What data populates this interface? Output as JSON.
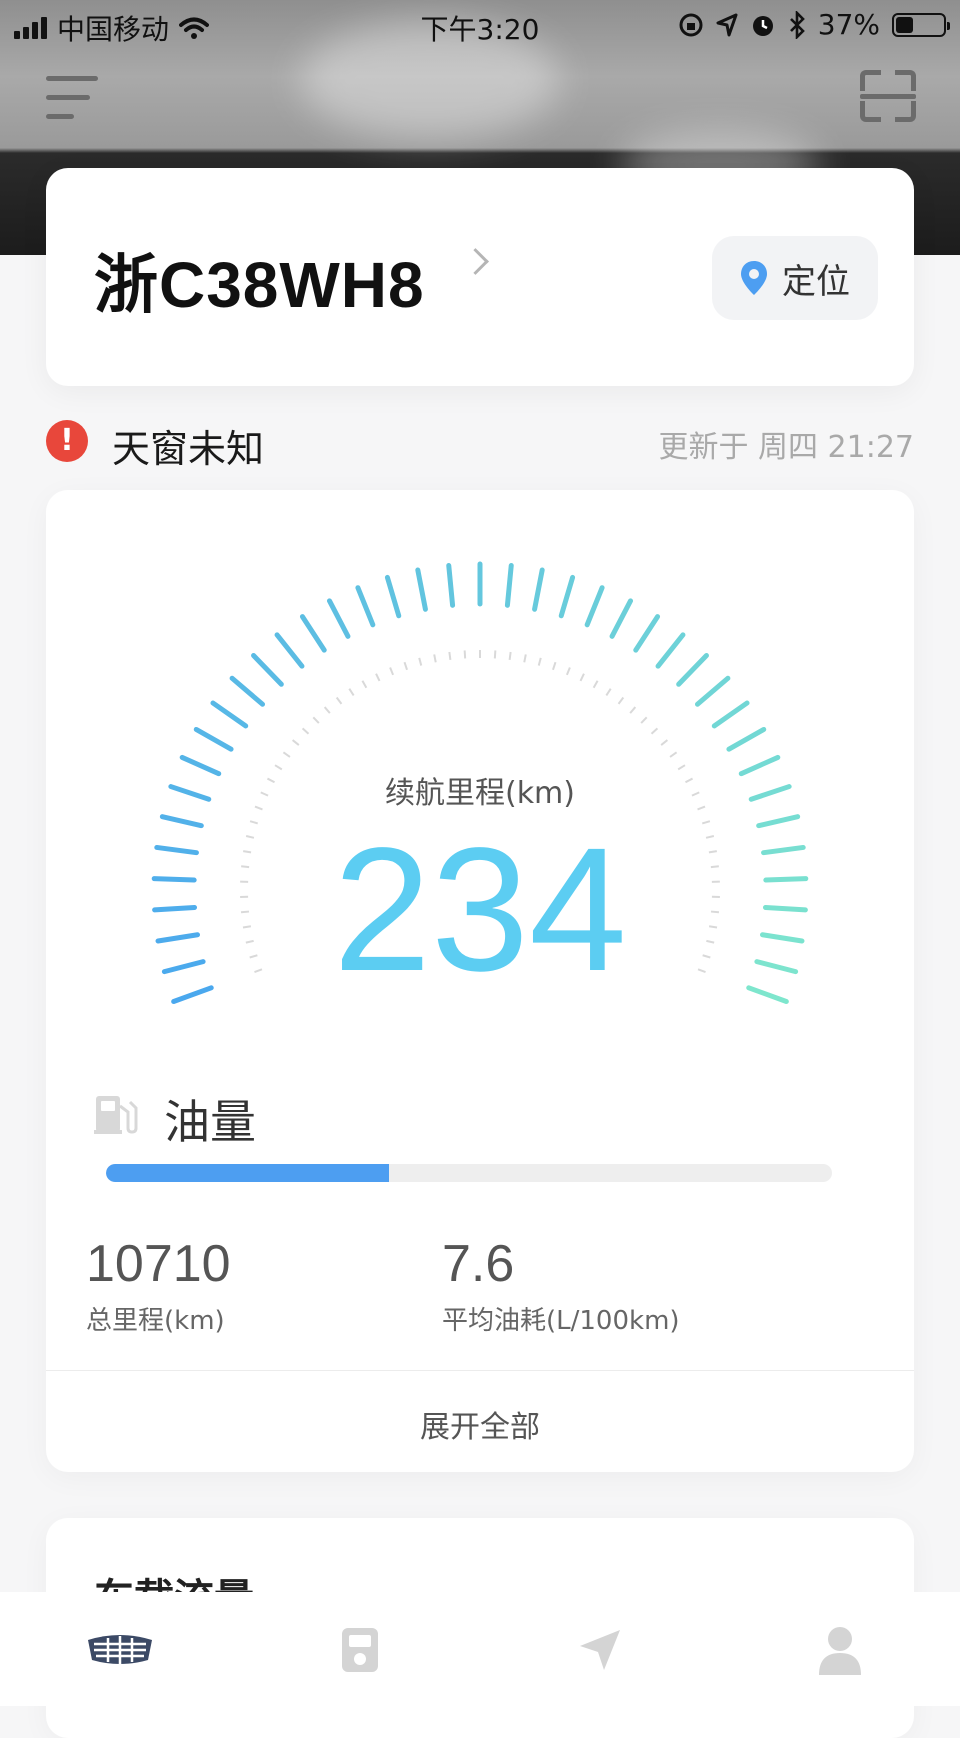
{
  "status_bar": {
    "carrier": "中国移动",
    "time": "下午3:20",
    "battery": "37%",
    "battery_level": 0.37
  },
  "vehicle": {
    "plate": "浙C38WH8",
    "locate_label": "定位"
  },
  "alert": {
    "text": "天窗未知",
    "updated": "更新于 周四 21:27",
    "color": "#e8473b"
  },
  "range": {
    "label": "续航里程(km)",
    "value": "234",
    "color": "#5ccdf2"
  },
  "fuel": {
    "label": "油量",
    "level": 0.39,
    "color": "#4d9ef1"
  },
  "stats": {
    "odometer_value": "10710",
    "odometer_label": "总里程(km)",
    "consumption_value": "7.6",
    "consumption_label": "平均油耗(L/100km)"
  },
  "expand_label": "展开全部",
  "data_card": {
    "title": "车载流量"
  },
  "tab_bar": {
    "items": [
      "car-logo-icon",
      "fuel-station-icon",
      "navigation-icon",
      "person-icon"
    ]
  }
}
